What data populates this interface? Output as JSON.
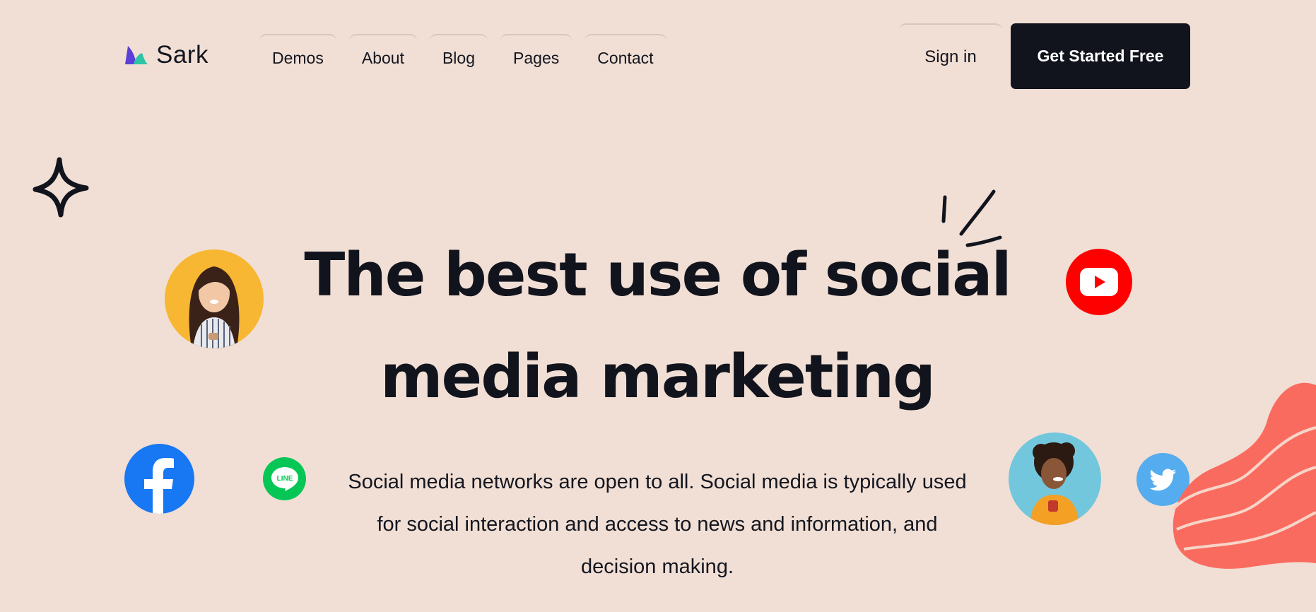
{
  "brand": {
    "name": "Sark",
    "logo_icon": "shark-fin-logo"
  },
  "nav": {
    "items": [
      {
        "label": "Demos"
      },
      {
        "label": "About"
      },
      {
        "label": "Blog"
      },
      {
        "label": "Pages"
      },
      {
        "label": "Contact"
      }
    ]
  },
  "header": {
    "signin_label": "Sign in",
    "cta_label": "Get Started Free"
  },
  "hero": {
    "headline_line1": "The best use of social",
    "headline_line2": "media marketing",
    "description_line1": "Social media networks are open to all. Social media is typically used",
    "description_line2": "for social interaction and access to news and information, and",
    "description_line3": "decision making."
  },
  "icons": [
    "sparkle-icon",
    "youtube-icon",
    "facebook-icon",
    "line-icon",
    "twitter-icon"
  ],
  "colors": {
    "background": "#f1dfd5",
    "dark": "#12141d",
    "youtube": "#ff0000",
    "facebook": "#1877f2",
    "line": "#06c755",
    "twitter": "#55acee",
    "blob": "#fa6b5f"
  }
}
